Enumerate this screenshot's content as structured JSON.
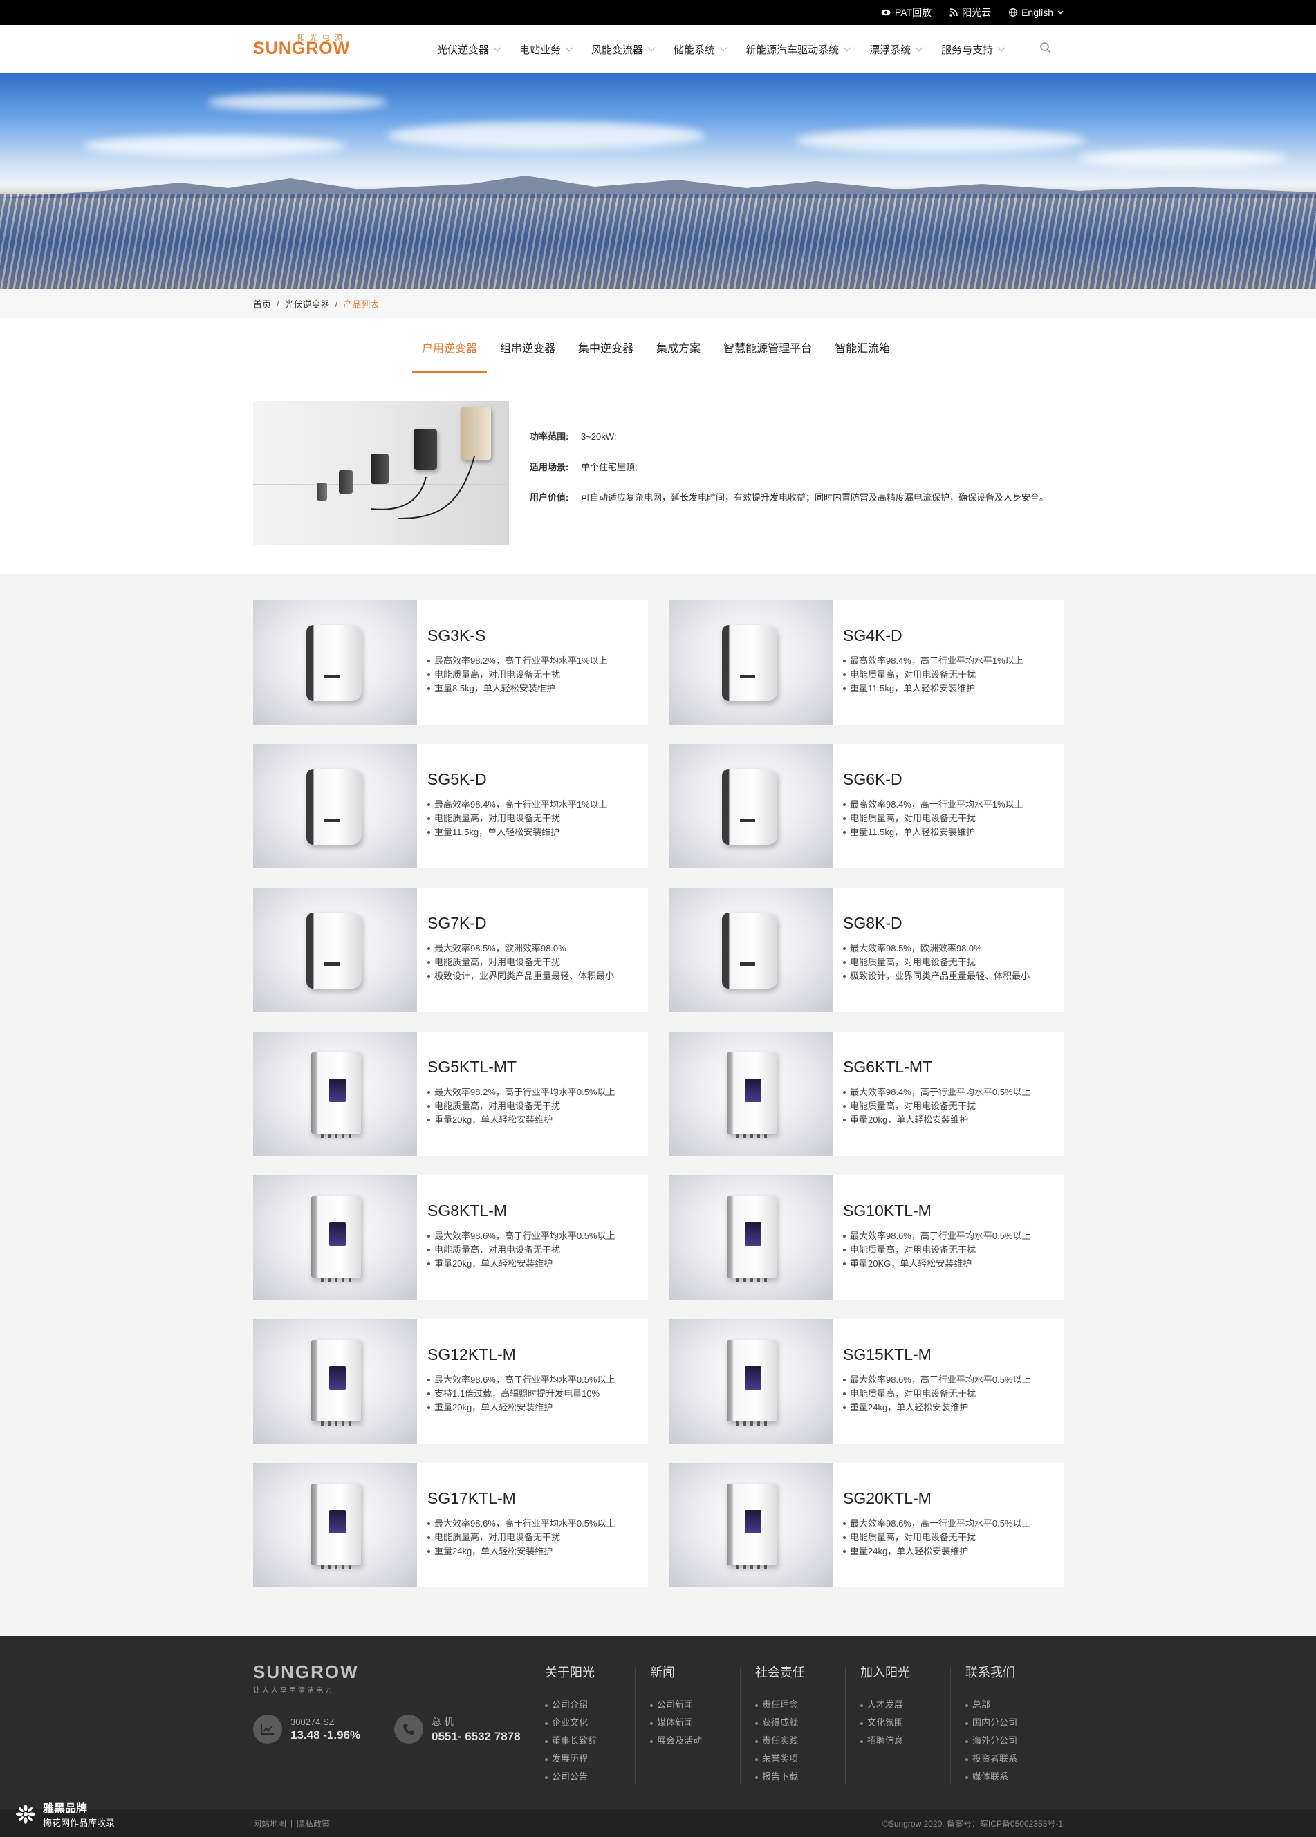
{
  "topbar": {
    "links": [
      {
        "icon": "eye-icon",
        "label": "PAT回放"
      },
      {
        "icon": "rss-icon",
        "label": "阳光云"
      },
      {
        "icon": "globe-icon",
        "label": "English"
      }
    ]
  },
  "header": {
    "logo_cn": "阳光电源",
    "logo_en": "SUNGROW",
    "nav": [
      "光伏逆变器",
      "电站业务",
      "风能变流器",
      "储能系统",
      "新能源汽车驱动系统",
      "漂浮系统",
      "服务与支持"
    ]
  },
  "breadcrumb": {
    "items": [
      "首页",
      "光伏逆变器"
    ],
    "current": "产品列表",
    "separator": "/"
  },
  "tabs": [
    "户用逆变器",
    "组串逆变器",
    "集中逆变器",
    "集成方案",
    "智慧能源管理平台",
    "智能汇流箱"
  ],
  "intro": {
    "rows": [
      {
        "label": "功率范围:",
        "value": "3~20kW;"
      },
      {
        "label": "适用场景:",
        "value": "单个住宅屋顶;"
      },
      {
        "label": "用户价值:",
        "value": "可自动适应复杂电网，延长发电时间，有效提升发电收益；同时内置防雷及高精度漏电流保护，确保设备及人身安全。"
      }
    ]
  },
  "products": [
    {
      "name": "SG3K-S",
      "style": "wide",
      "features": [
        "最高效率98.2%，高于行业平均水平1%以上",
        "电能质量高，对用电设备无干扰",
        "重量8.5kg，单人轻松安装维护"
      ]
    },
    {
      "name": "SG4K-D",
      "style": "wide",
      "features": [
        "最高效率98.4%，高于行业平均水平1%以上",
        "电能质量高，对用电设备无干扰",
        "重量11.5kg，单人轻松安装维护"
      ]
    },
    {
      "name": "SG5K-D",
      "style": "wide",
      "features": [
        "最高效率98.4%，高于行业平均水平1%以上",
        "电能质量高，对用电设备无干扰",
        "重量11.5kg，单人轻松安装维护"
      ]
    },
    {
      "name": "SG6K-D",
      "style": "wide",
      "features": [
        "最高效率98.4%，高于行业平均水平1%以上",
        "电能质量高，对用电设备无干扰",
        "重量11.5kg，单人轻松安装维护"
      ]
    },
    {
      "name": "SG7K-D",
      "style": "wide",
      "features": [
        "最大效率98.5%，欧洲效率98.0%",
        "电能质量高，对用电设备无干扰",
        "极致设计，业界同类产品重量最轻、体积最小"
      ]
    },
    {
      "name": "SG8K-D",
      "style": "wide",
      "features": [
        "最大效率98.5%，欧洲效率98.0%",
        "电能质量高，对用电设备无干扰",
        "极致设计，业界同类产品重量最轻、体积最小"
      ]
    },
    {
      "name": "SG5KTL-MT",
      "style": "tall",
      "features": [
        "最大效率98.2%，高于行业平均水平0.5%以上",
        "电能质量高，对用电设备无干扰",
        "重量20kg，单人轻松安装维护"
      ]
    },
    {
      "name": "SG6KTL-MT",
      "style": "tall",
      "features": [
        "最大效率98.4%，高于行业平均水平0.5%以上",
        "电能质量高，对用电设备无干扰",
        "重量20kg，单人轻松安装维护"
      ]
    },
    {
      "name": "SG8KTL-M",
      "style": "tall",
      "features": [
        "最大效率98.6%，高于行业平均水平0.5%以上",
        "电能质量高，对用电设备无干扰",
        "重量20kg，单人轻松安装维护"
      ]
    },
    {
      "name": "SG10KTL-M",
      "style": "tall",
      "features": [
        "最大效率98.6%，高于行业平均水平0.5%以上",
        "电能质量高，对用电设备无干扰",
        "重量20KG，单人轻松安装维护"
      ]
    },
    {
      "name": "SG12KTL-M",
      "style": "tall",
      "features": [
        "最大效率98.6%，高于行业平均水平0.5%以上",
        "支持1.1倍过载，高辐照时提升发电量10%",
        "重量20kg，单人轻松安装维护"
      ]
    },
    {
      "name": "SG15KTL-M",
      "style": "tall",
      "features": [
        "最大效率98.6%，高于行业平均水平0.5%以上",
        "电能质量高，对用电设备无干扰",
        "重量24kg，单人轻松安装维护"
      ]
    },
    {
      "name": "SG17KTL-M",
      "style": "tall",
      "features": [
        "最大效率98.6%，高于行业平均水平0.5%以上",
        "电能质量高，对用电设备无干扰",
        "重量24kg，单人轻松安装维护"
      ]
    },
    {
      "name": "SG20KTL-M",
      "style": "tall",
      "features": [
        "最大效率98.6%，高于行业平均水平0.5%以上",
        "电能质量高，对用电设备无干扰",
        "重量24kg，单人轻松安装维护"
      ]
    }
  ],
  "footer": {
    "logo_en": "SUNGROW",
    "slogan": "让人人享用清洁电力",
    "stock_code": "300274.SZ",
    "stock_price": "13.48  -1.96%",
    "phone_label": "总 机",
    "phone_number": "0551- 6532 7878",
    "columns": [
      {
        "title": "关于阳光",
        "items": [
          "公司介绍",
          "企业文化",
          "董事长致辞",
          "发展历程",
          "公司公告"
        ]
      },
      {
        "title": "新闻",
        "items": [
          "公司新闻",
          "媒体新闻",
          "展会及活动"
        ]
      },
      {
        "title": "社会责任",
        "items": [
          "责任理念",
          "获得成就",
          "责任实践",
          "荣誉奖项",
          "报告下载"
        ]
      },
      {
        "title": "加入阳光",
        "items": [
          "人才发展",
          "文化氛围",
          "招聘信息"
        ]
      },
      {
        "title": "联系我们",
        "items": [
          "总部",
          "国内分公司",
          "海外分公司",
          "投资者联系",
          "媒体联系"
        ]
      }
    ],
    "bottom_left": [
      "网站地图",
      "隐私政策"
    ],
    "bottom_sep": "|",
    "copyright": "©Sungrow 2020.  备案号：皖ICP备05002353号-1"
  },
  "watermark": {
    "title": "雅黑品牌",
    "subtitle": "梅花网作品库收录"
  },
  "colors": {
    "accent": "#e8782a",
    "footer_bg": "#2c2c2c",
    "topbar_bg": "#000000"
  }
}
